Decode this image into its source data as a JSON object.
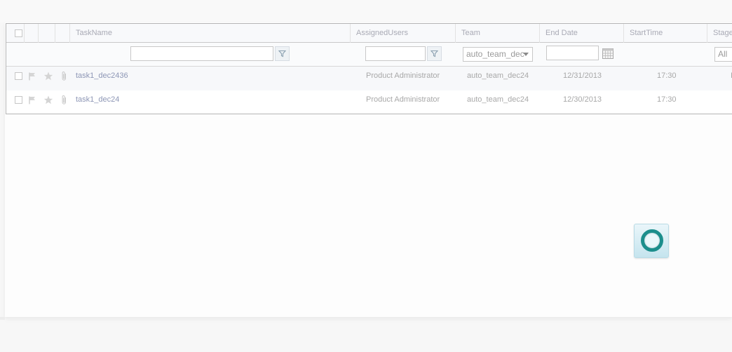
{
  "grid": {
    "columns": {
      "task_name": "TaskName",
      "assigned_users": "AssignedUsers",
      "team": "Team",
      "end_date": "End Date",
      "start_time": "StartTime",
      "stage": "Stage"
    },
    "filters": {
      "task_name_value": "",
      "assigned_users_value": "",
      "team_selected": "auto_team_dec",
      "end_date_value": "",
      "stage_selected": "All"
    },
    "rows": [
      {
        "task_name": "task1_dec2436",
        "assigned_users": "Product Administrator",
        "team": "auto_team_dec24",
        "end_date": "12/31/2013",
        "start_time": "17:30",
        "stage": "I"
      },
      {
        "task_name": "task1_dec24",
        "assigned_users": "Product Administrator",
        "team": "auto_team_dec24",
        "end_date": "12/30/2013",
        "start_time": "17:30",
        "stage": ""
      }
    ]
  },
  "icons": {
    "filter": "filter-funnel-icon",
    "calendar": "calendar-icon",
    "flag": "flag-icon",
    "star": "star-icon",
    "attachment": "paperclip-icon",
    "loading": "loading-spinner-icon"
  },
  "colors": {
    "link": "#8e97b6",
    "grid_border": "#b5b5b5",
    "spinner_ring": "#1c8e8c"
  }
}
